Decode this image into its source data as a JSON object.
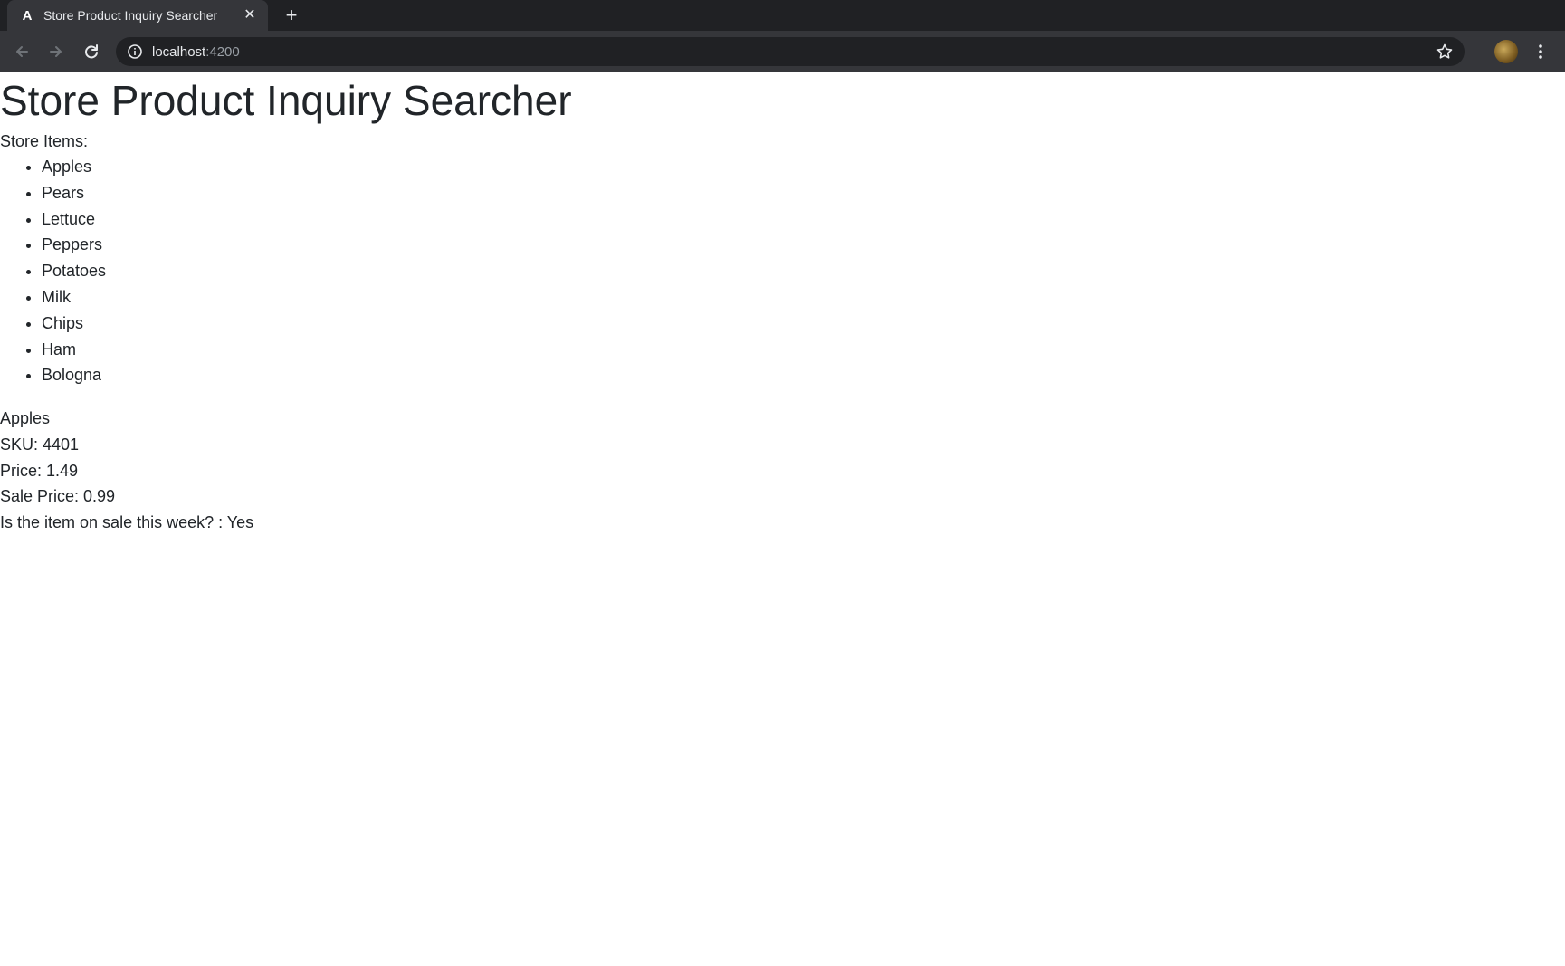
{
  "browser": {
    "tab_title": "Store Product Inquiry Searcher",
    "tab_favicon": "A",
    "url_host": "localhost",
    "url_port": ":4200"
  },
  "page": {
    "title": "Store Product Inquiry Searcher",
    "items_label": "Store Items:",
    "items": [
      "Apples",
      "Pears",
      "Lettuce",
      "Peppers",
      "Potatoes",
      "Milk",
      "Chips",
      "Ham",
      "Bologna"
    ],
    "selected": {
      "name": "Apples",
      "sku_label": "SKU: 4401",
      "price_label": "Price: 1.49",
      "sale_price_label": "Sale Price: 0.99",
      "on_sale_label": "Is the item on sale this week? : Yes"
    }
  },
  "colors": {
    "tabstrip": "#202124",
    "toolbar": "#35363a",
    "text": "#212529"
  }
}
